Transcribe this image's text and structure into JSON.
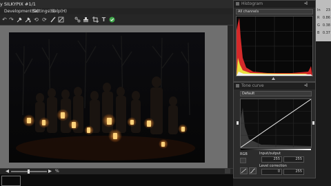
{
  "window": {
    "title": "y SILKYPIX  #1/1"
  },
  "menu": {
    "items": [
      {
        "label": "Development(D)"
      },
      {
        "label": "Settings(S)"
      },
      {
        "label": "Help(H)"
      }
    ]
  },
  "toolbar": {
    "icons": [
      "undo-arrow-icon",
      "redo-arrow-icon",
      "pipette-icon",
      "pipette-plus-icon",
      "rotate-left-icon",
      "rotate-right-icon",
      "brush-icon",
      "gradient-brush-icon",
      "links-icon",
      "stamp-icon",
      "crop-icon",
      "text-icon",
      "check-icon"
    ]
  },
  "status": {
    "zoom": "%"
  },
  "histogram": {
    "title": "Histogram",
    "channel": "All channels"
  },
  "info": {
    "rows": [
      {
        "key": "In",
        "value": "23"
      },
      {
        "key": "R",
        "value": "0.86"
      },
      {
        "key": "G",
        "value": "0.38"
      },
      {
        "key": "B",
        "value": "0.37"
      }
    ]
  },
  "tone_curve": {
    "title": "Tone curve",
    "preset": "Default",
    "channel": "RGB",
    "input_output_label": "Input/output",
    "input_value": "255",
    "output_value": "255",
    "level_label": "Level correction",
    "level_low": "0",
    "level_high": "255"
  }
}
